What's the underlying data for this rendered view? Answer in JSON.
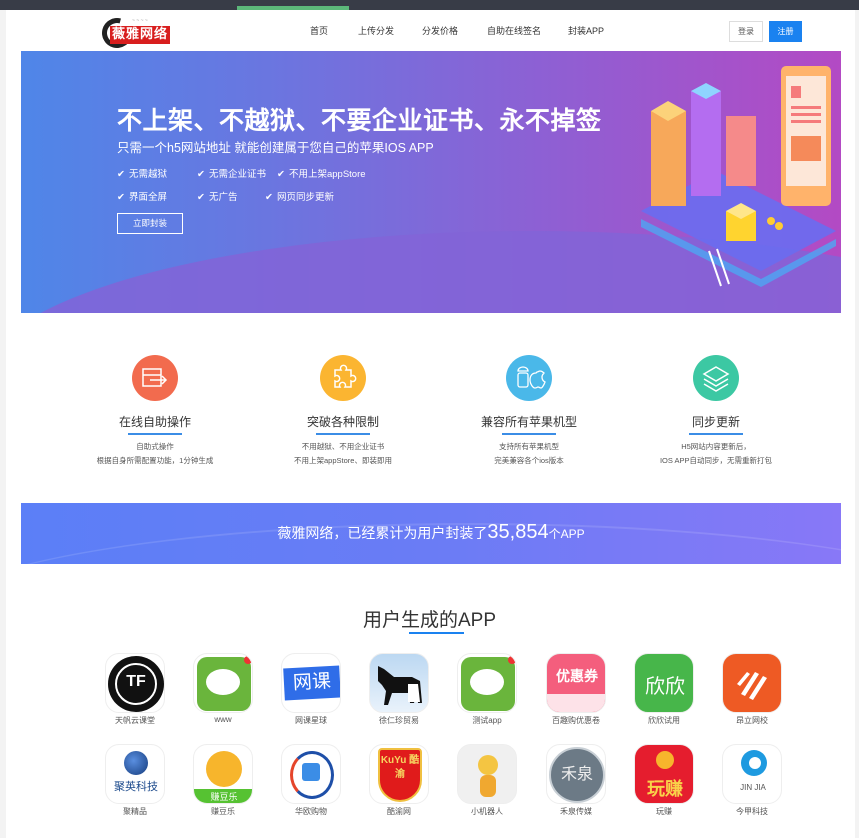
{
  "header": {
    "logo_text": "薇雅网络",
    "nav": [
      "首页",
      "上传分发",
      "分发价格",
      "自助在线签名",
      "封装APP"
    ],
    "login_label": "登录",
    "register_label": "注册"
  },
  "hero": {
    "title": "不上架、不越狱、不要企业证书、永不掉签",
    "subtitle": "只需一个h5网站地址 就能创建属于您自己的苹果IOS APP",
    "check_icon": "✔",
    "features_row1": [
      "无需越狱",
      "无需企业证书",
      "不用上架appStore"
    ],
    "features_row2": [
      "界面全屏",
      "无广告",
      "网页同步更新"
    ],
    "cta_label": "立即封装"
  },
  "features": [
    {
      "icon": "online-operation-icon",
      "color": "#f26b4e",
      "title": "在线自助操作",
      "lines": [
        "自助式操作",
        "根据自身所需配置功能，1分钟生成"
      ]
    },
    {
      "icon": "puzzle-icon",
      "color": "#fbb531",
      "title": "突破各种限制",
      "lines": [
        "不用越狱、不用企业证书",
        "不用上架appStore、即装即用"
      ]
    },
    {
      "icon": "android-apple-icon",
      "color": "#4ab8e9",
      "title": "兼容所有苹果机型",
      "lines": [
        "支持所有苹果机型",
        "完美兼容各个ios版本"
      ]
    },
    {
      "icon": "layers-icon",
      "color": "#3cc8a3",
      "title": "同步更新",
      "lines": [
        "H5网站内容更新后，",
        "IOS APP自动同步，无需重新打包"
      ]
    }
  ],
  "banner": {
    "prefix": "薇雅网络，已经累计为用户封装了",
    "count": "35,854",
    "suffix": "个APP"
  },
  "apps_section": {
    "title": "用户生成的APP",
    "apps": [
      {
        "name": "天帆云课堂",
        "icon_text": "TF"
      },
      {
        "name": "www",
        "icon_text": ""
      },
      {
        "name": "网课星球",
        "icon_text": "网课"
      },
      {
        "name": "徐仁珍贸易",
        "icon_text": ""
      },
      {
        "name": "测试app",
        "icon_text": ""
      },
      {
        "name": "百趣购优惠卷",
        "icon_text": "优惠券"
      },
      {
        "name": "欣欣试用",
        "icon_text": "欣欣"
      },
      {
        "name": "昂立网校",
        "icon_text": ""
      },
      {
        "name": "聚精品",
        "icon_text": "聚英科技"
      },
      {
        "name": "赚豆乐",
        "icon_text": "赚豆乐"
      },
      {
        "name": "华欧购物",
        "icon_text": ""
      },
      {
        "name": "酷渝网",
        "icon_text": "KuYu 酷渝"
      },
      {
        "name": "小机器人",
        "icon_text": ""
      },
      {
        "name": "禾泉传媒",
        "icon_text": "禾泉"
      },
      {
        "name": "玩赚",
        "icon_text": "玩赚"
      },
      {
        "name": "今甲科技",
        "icon_text": "JIN JIA"
      }
    ]
  }
}
